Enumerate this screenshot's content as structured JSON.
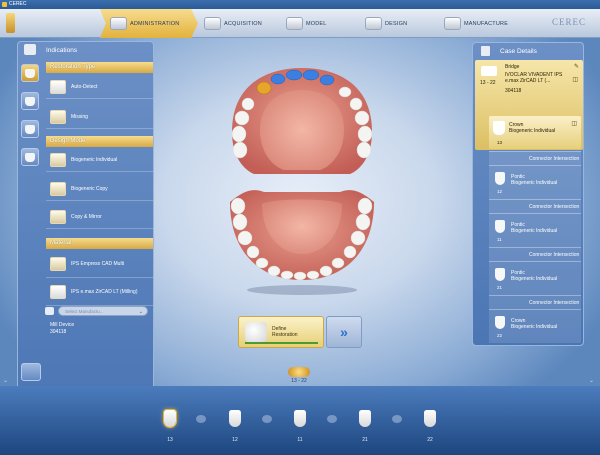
{
  "window": {
    "title": "CEREC"
  },
  "nav": {
    "steps": [
      {
        "label": "ADMINISTRATION",
        "active": true
      },
      {
        "label": "ACQUISITION",
        "active": false
      },
      {
        "label": "MODEL",
        "active": false
      },
      {
        "label": "DESIGN",
        "active": false
      },
      {
        "label": "MANUFACTURE",
        "active": false
      }
    ],
    "brand": "CEREC"
  },
  "left_panel": {
    "title": "Indications",
    "restoration_type": {
      "header": "Restoration Type",
      "options": [
        "Auto-Detect",
        "Missing"
      ]
    },
    "design_mode": {
      "header": "Design Mode",
      "options": [
        "Biogeneric Individual",
        "Biogeneric Copy",
        "Copy & Mirror"
      ]
    },
    "material": {
      "header": "Material",
      "options": [
        "IPS Empress CAD Multi",
        "IPS e.max ZirCAD LT (Milling)"
      ],
      "select_placeholder": "Select Manufactu..."
    },
    "mill_device": {
      "label": "Mill Device",
      "value": "304118"
    }
  },
  "define": {
    "label_line1": "Define",
    "label_line2": "Restoration",
    "next_symbol": "»"
  },
  "right_panel": {
    "title": "Case Details",
    "bridge": {
      "type": "Bridge",
      "range": "13 - 22",
      "material": "IVOCLAR VIVADENT IPS e.max ZirCAD LT (...",
      "device": "304118"
    },
    "items": [
      {
        "kind": "crown",
        "name": "Crown",
        "mode": "Biogeneric Individual",
        "tooth": "13"
      },
      {
        "kind": "connector",
        "label": "Connector Intersection"
      },
      {
        "kind": "pontic",
        "name": "Pontic",
        "mode": "Biogeneric Individual",
        "tooth": "12"
      },
      {
        "kind": "connector",
        "label": "Connector Intersection"
      },
      {
        "kind": "pontic",
        "name": "Pontic",
        "mode": "Biogeneric Individual",
        "tooth": "11"
      },
      {
        "kind": "connector",
        "label": "Connector Intersection"
      },
      {
        "kind": "pontic",
        "name": "Pontic",
        "mode": "Biogeneric Individual",
        "tooth": "21"
      },
      {
        "kind": "connector",
        "label": "Connector Intersection"
      },
      {
        "kind": "crown",
        "name": "Crown",
        "mode": "Biogeneric Individual",
        "tooth": "22"
      }
    ]
  },
  "selection_range": "13 - 22",
  "tooth_strip": [
    "13",
    "12",
    "11",
    "21",
    "22"
  ],
  "colors": {
    "accent": "#e2b23c",
    "panel": "#5a82bd",
    "background": "#2b5a95"
  }
}
